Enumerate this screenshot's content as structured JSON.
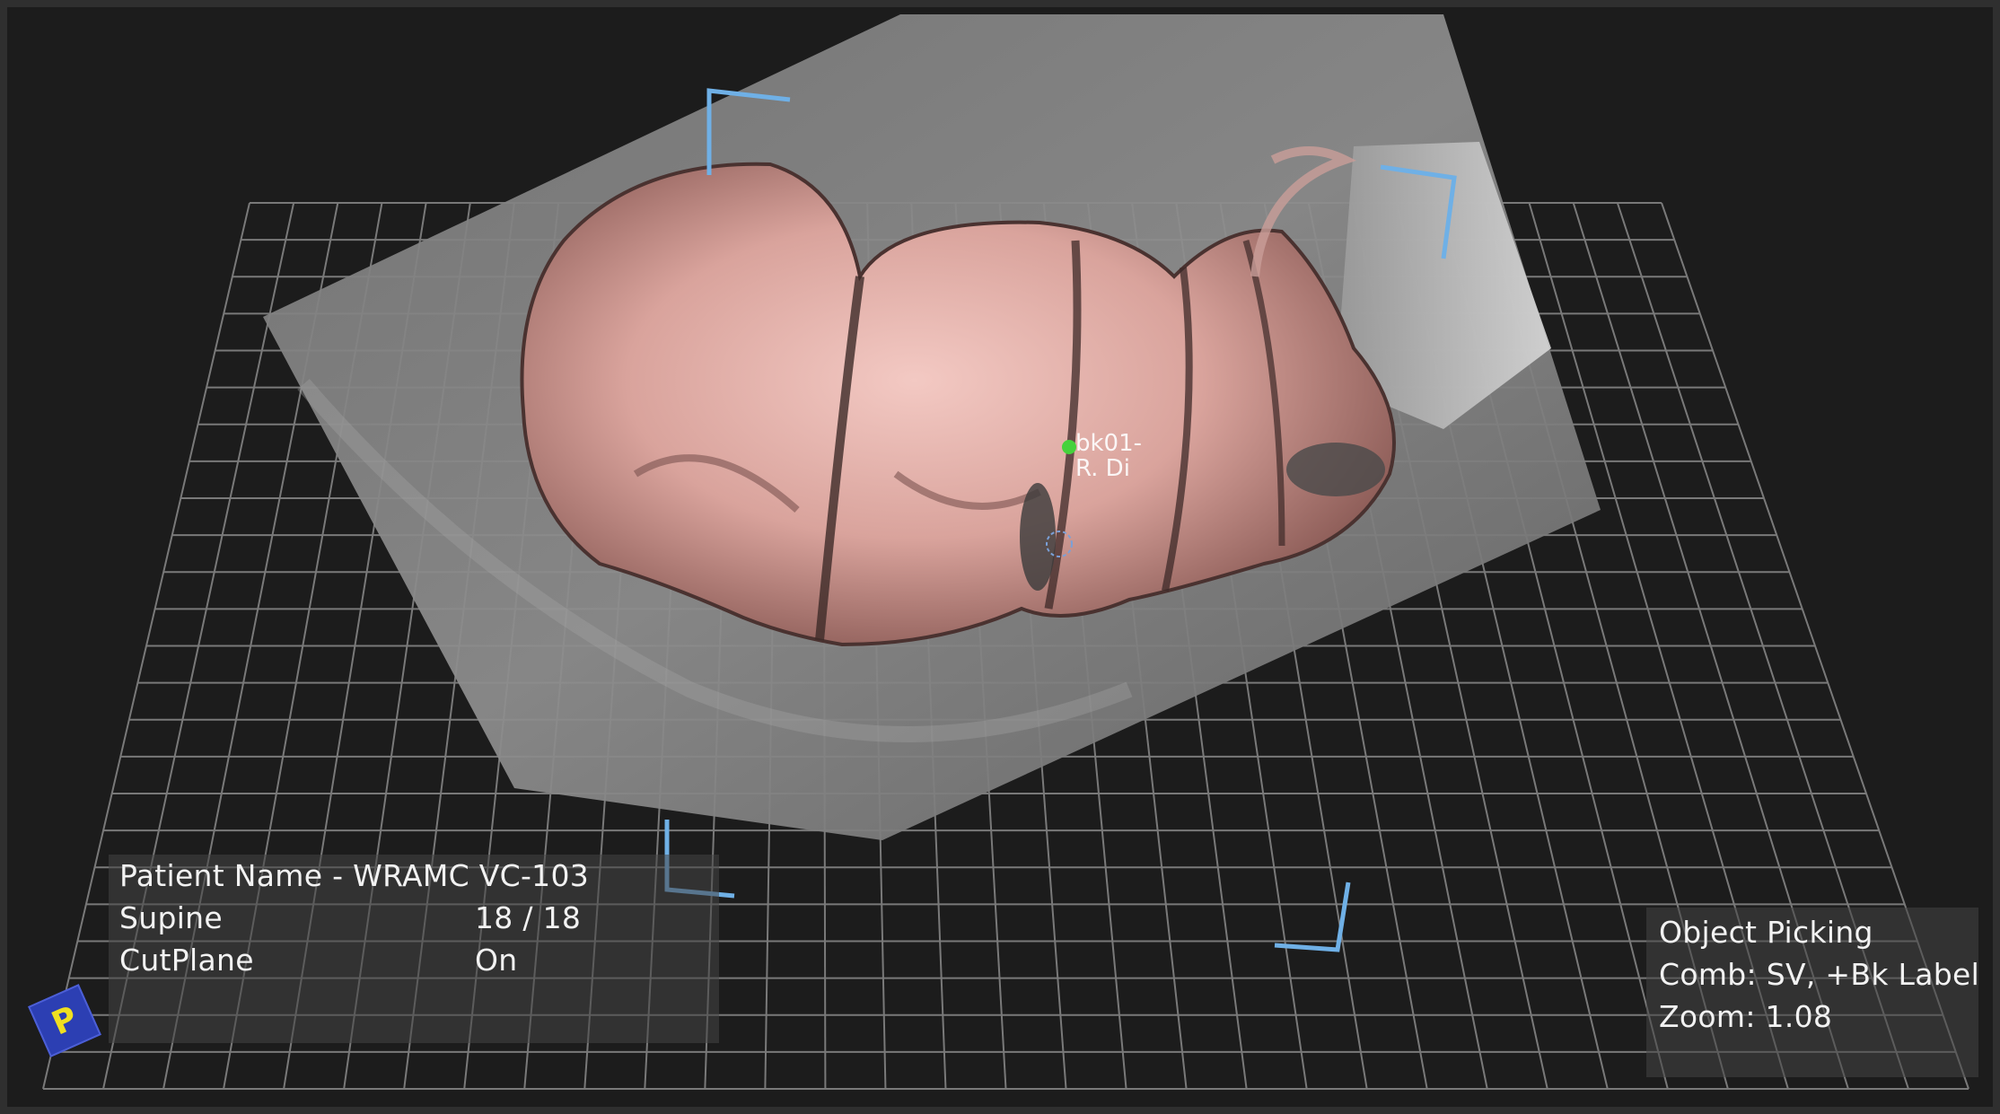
{
  "viewer": {
    "grid_color": "#8a8a8a",
    "corner_bracket_color": "#6fb0e6",
    "background_color": "#1c1c1c",
    "colon_surface_color": "#d9a39c",
    "ct_slab_color": "#8c8c8c"
  },
  "overlay_left": {
    "patient_name": "Patient Name - WRAMC VC-103",
    "position_label": "Supine",
    "position_value": "18 / 18",
    "cutplane_label": "CutPlane",
    "cutplane_value": "On"
  },
  "overlay_right": {
    "mode": "Object Picking",
    "combination": "Comb: SV, +Bk Label",
    "zoom": "Zoom: 1.08"
  },
  "orientation_marker": {
    "letter": "P",
    "color": "#2c3fb3"
  },
  "picked_object": {
    "line1": "bk01-",
    "line2": "R. Di"
  },
  "icons": [
    "orientation-cube-icon",
    "pick-marker-icon"
  ]
}
